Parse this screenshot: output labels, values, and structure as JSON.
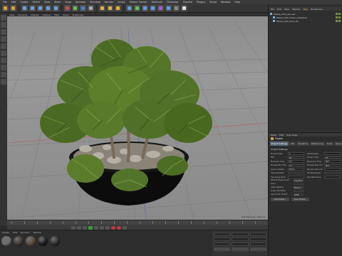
{
  "menubar": {
    "items": [
      "File",
      "Edit",
      "Create",
      "Select",
      "Tools",
      "Mesh",
      "Snap",
      "Animate",
      "Simulate",
      "Render",
      "Sculpt",
      "Motion Tracker",
      "MoGraph",
      "Character",
      "Pipeline",
      "Plugins",
      "Script",
      "Window",
      "Help"
    ]
  },
  "toolbar": {
    "icons": [
      {
        "name": "undo-icon",
        "color": "#d8a030"
      },
      {
        "name": "redo-icon",
        "color": "#d8a030"
      },
      {
        "name": "live-select-icon",
        "color": "#6aa0d8"
      },
      {
        "name": "move-icon",
        "color": "#6aa0d8"
      },
      {
        "name": "scale-icon",
        "color": "#6aa0d8"
      },
      {
        "name": "rotate-icon",
        "color": "#6aa0d8"
      },
      {
        "name": "recent-tools-icon",
        "color": "#6aa0d8"
      },
      {
        "name": "x-axis-icon",
        "color": "#d04a4a"
      },
      {
        "name": "y-axis-icon",
        "color": "#6ac04a"
      },
      {
        "name": "z-axis-icon",
        "color": "#4a7ad0"
      },
      {
        "name": "coordinate-system-icon",
        "color": "#aaaaaa"
      },
      {
        "name": "render-view-icon",
        "color": "#e0b040"
      },
      {
        "name": "render-picture-viewer-icon",
        "color": "#e0b040"
      },
      {
        "name": "render-settings-icon",
        "color": "#e0b040"
      },
      {
        "name": "cube-icon",
        "color": "#5aa0e0"
      },
      {
        "name": "pen-icon",
        "color": "#6ac04a"
      },
      {
        "name": "subdivision-surface-icon",
        "color": "#5aa0e0"
      },
      {
        "name": "array-icon",
        "color": "#5aa0e0"
      },
      {
        "name": "bend-deformer-icon",
        "color": "#a060d0"
      },
      {
        "name": "floor-icon",
        "color": "#5aa0e0"
      },
      {
        "name": "camera-icon",
        "color": "#888888"
      },
      {
        "name": "light-icon",
        "color": "#e0e0e0"
      }
    ]
  },
  "viewport": {
    "menu": [
      "View",
      "Cameras",
      "Display",
      "Options",
      "Filter",
      "Panel",
      "ProRender"
    ],
    "hud": "Grid Spacing : 100 cm"
  },
  "timeline": {
    "ticks": 20
  },
  "materials": {
    "menu": [
      "Create",
      "Edit",
      "Function",
      "Texture"
    ],
    "swatches": [
      {
        "name": "material-swatch",
        "color": "#6b6b6b"
      },
      {
        "name": "material-swatch",
        "color": "#3a3530"
      },
      {
        "name": "material-swatch",
        "color": "#5a4a38"
      },
      {
        "name": "material-swatch",
        "color": "#1a1a1a"
      },
      {
        "name": "material-swatch",
        "color": "#2a2a2a"
      }
    ]
  },
  "coords": {
    "apply": "Apply",
    "world": "World",
    "size": "Size"
  },
  "object_manager": {
    "menu": [
      "File",
      "Edit",
      "View",
      "Objects",
      "Tags",
      "Bookmarks"
    ],
    "active_menu": "Tags",
    "items": [
      "Model_C4D_Lite.c4d",
      "Model_LOD_Grass_Collection",
      "Model_C4D_Dirt_Lite"
    ]
  },
  "attributes": {
    "menu": [
      "Mode",
      "Edit",
      "User Data"
    ],
    "title": "Project",
    "tabs": [
      "Project Settings",
      "Info",
      "Dynamics",
      "Referencing",
      "To Do",
      "Key Interpolation"
    ],
    "section": "Project Settings",
    "params": [
      {
        "label": "Project Scale",
        "value": "1"
      },
      {
        "label": "Centimeters",
        "value": ""
      },
      {
        "label": "FPS",
        "value": "30"
      },
      {
        "label": "Project Time",
        "value": "0 F"
      },
      {
        "label": "Minimum Time",
        "value": "0 F"
      },
      {
        "label": "Maximum Time",
        "value": "90 F"
      },
      {
        "label": "Preview Min Time",
        "value": "0 F"
      },
      {
        "label": "Preview Max Time",
        "value": "90 F"
      },
      {
        "label": "Level of Detail",
        "value": "100 %"
      },
      {
        "label": "Render LOD in Editor",
        "value": ""
      },
      {
        "label": "Use Animation",
        "value": ""
      },
      {
        "label": "Use Expression",
        "value": ""
      },
      {
        "label": "Use Generators",
        "value": ""
      },
      {
        "label": "Use Deformers",
        "value": ""
      }
    ],
    "rows": [
      {
        "label": "Default Object Color",
        "value": "Gray-Blue"
      },
      {
        "label": "Color",
        "value": ""
      },
      {
        "label": "View Clipping",
        "value": "Medium"
      },
      {
        "label": "Linear Workflow",
        "value": ""
      },
      {
        "label": "Input Color Profile",
        "value": "sRGB"
      }
    ],
    "buttons": [
      "Load Preset...",
      "Save Preset..."
    ]
  }
}
